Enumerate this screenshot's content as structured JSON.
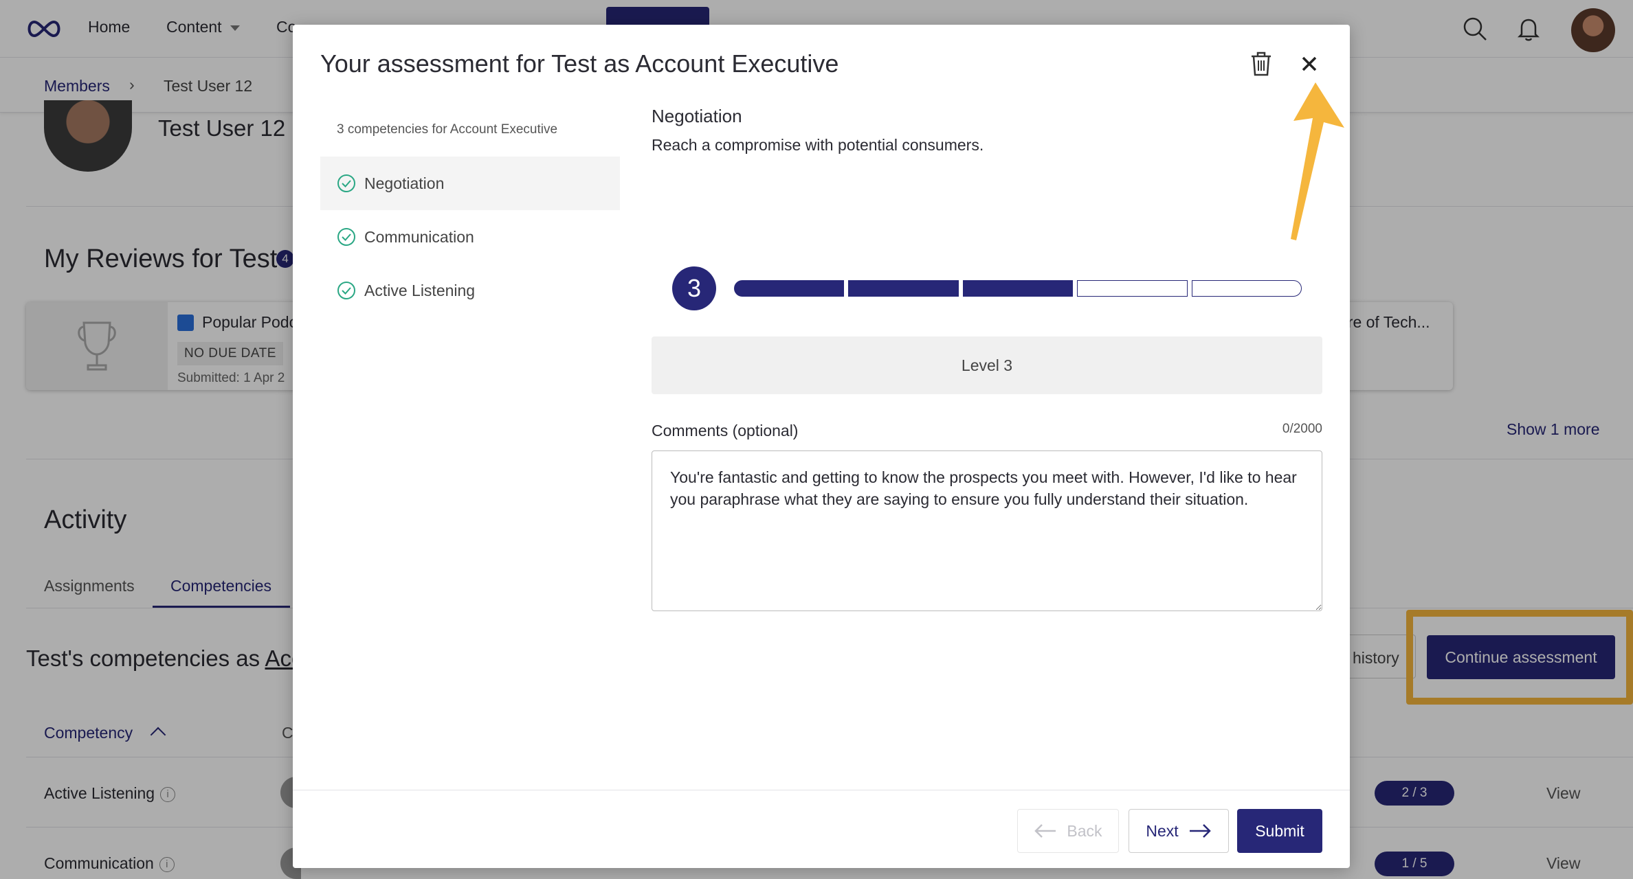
{
  "nav": {
    "items": [
      {
        "label": "Home"
      },
      {
        "label": "Content"
      },
      {
        "label": "Co"
      }
    ]
  },
  "breadcrumb": {
    "parent": "Members",
    "current": "Test User 12"
  },
  "profile": {
    "name": "Test User 12"
  },
  "reviews": {
    "title": "My Reviews for Test",
    "badge": "4",
    "card": {
      "title": "Popular Podc",
      "due": "NO DUE DATE",
      "submitted": "Submitted: 1 Apr 2",
      "right_title": "ure of Tech..."
    },
    "show_more": "Show 1 more"
  },
  "activity": {
    "title": "Activity",
    "tabs": [
      {
        "label": "Assignments"
      },
      {
        "label": "Competencies"
      }
    ]
  },
  "competencies": {
    "title_prefix": "Test's competencies as ",
    "title_link": "Acc",
    "history_label": "history",
    "continue_label": "Continue assessment",
    "table": {
      "col1": "Competency",
      "col2": "C",
      "rows": [
        {
          "name": "Active Listening",
          "progress": "2 / 3",
          "view": "View"
        },
        {
          "name": "Communication",
          "progress": "1 / 5",
          "view": "View"
        }
      ]
    }
  },
  "modal": {
    "title": "Your assessment for Test as Account Executive",
    "sidebar": {
      "count_label": "3 competencies for Account Executive",
      "items": [
        {
          "label": "Negotiation"
        },
        {
          "label": "Communication"
        },
        {
          "label": "Active Listening"
        }
      ]
    },
    "section": {
      "title": "Negotiation",
      "description": "Reach a compromise with potential consumers."
    },
    "level": {
      "current": "3",
      "max": 5,
      "label": "Level 3"
    },
    "comments": {
      "label": "Comments (optional)",
      "count": "0/2000",
      "value": "You're fantastic and getting to know the prospects you meet with. However, I'd like to hear you paraphrase what they are saying to ensure you fully understand their situation."
    },
    "footer": {
      "back_label": "Back",
      "next_label": "Next",
      "submit_label": "Submit"
    }
  },
  "colors": {
    "primary": "#272777",
    "success": "#2aa784",
    "highlight": "#f5b63d"
  },
  "icons": [
    "logo-icon",
    "search-icon",
    "bell-icon",
    "trash-icon",
    "close-icon",
    "check-circle-icon",
    "arrow-left-icon",
    "arrow-right-icon",
    "trophy-icon",
    "info-icon"
  ]
}
